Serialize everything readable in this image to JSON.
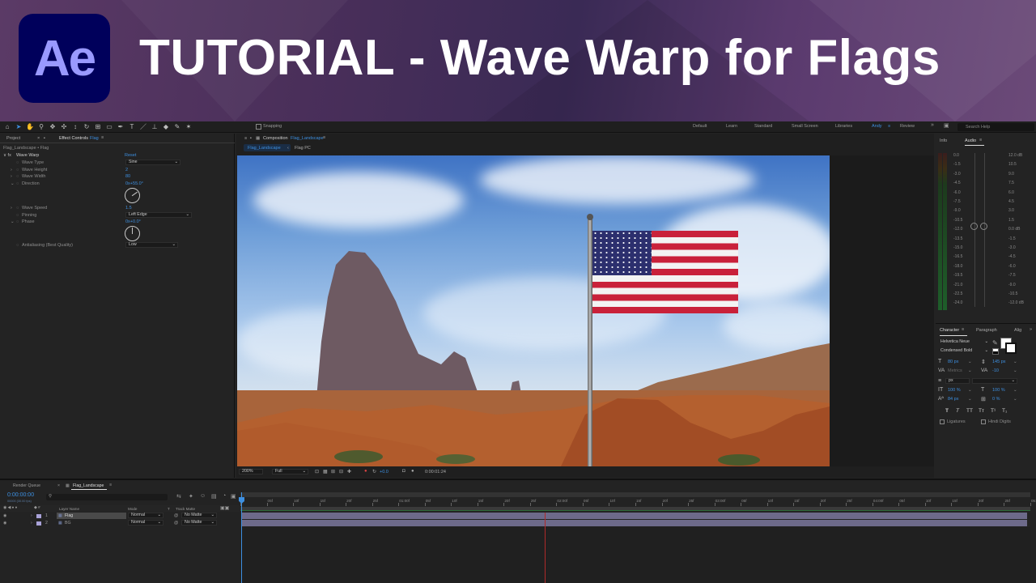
{
  "banner": {
    "logo_text": "Ae",
    "title": "TUTORIAL - Wave Warp for Flags",
    "logo_bg": "#00005b",
    "logo_fg": "#9999ff"
  },
  "toolbar": {
    "snapping_label": "Snapping",
    "workspaces": [
      "Default",
      "Learn",
      "Standard",
      "Small Screen",
      "Libraries",
      "Andy",
      "Review"
    ],
    "active_workspace": "Andy",
    "search_placeholder": "Search Help"
  },
  "left_panel": {
    "tab_project": "Project",
    "tab_effect_controls": "Effect Controls",
    "tab_effect_target": "Flag",
    "layer_path": "Flag_Landscape • Flag",
    "effect_name": "Wave Warp",
    "reset_label": "Reset",
    "properties": [
      {
        "label": "Wave Type",
        "value": "Sine",
        "kind": "dropdown"
      },
      {
        "label": "Wave Height",
        "value": "2",
        "kind": "number"
      },
      {
        "label": "Wave Width",
        "value": "80",
        "kind": "number"
      },
      {
        "label": "Direction",
        "value": "0x+55.0°",
        "kind": "angle"
      },
      {
        "label": "Wave Speed",
        "value": "1.5",
        "kind": "number"
      },
      {
        "label": "Pinning",
        "value": "Left Edge",
        "kind": "dropdown"
      },
      {
        "label": "Phase",
        "value": "0x+0.0°",
        "kind": "angle"
      },
      {
        "label": "Antialiasing (Best Quality)",
        "value": "Low",
        "kind": "dropdown"
      }
    ]
  },
  "comp_panel": {
    "tab_label": "Composition",
    "comp_name": "Flag_Landscape",
    "breadcrumb_1": "Flag_Landscape",
    "breadcrumb_2": "Flag PC",
    "zoom": "200%",
    "resolution": "Full",
    "exposure": "+0.0",
    "timecode": "0:00:01:24"
  },
  "right_panel": {
    "tab_info": "Info",
    "tab_audio": "Audio",
    "meter_left": [
      "0.0",
      "-1.5",
      "-3.0",
      "-4.5",
      "-6.0",
      "-7.5",
      "-9.0",
      "-10.5",
      "-12.0",
      "-13.5",
      "-15.0",
      "-16.5",
      "-18.0",
      "-19.5",
      "-21.0",
      "-22.5",
      "-24.0"
    ],
    "meter_right": [
      "12.0 dB",
      "10.5",
      "9.0",
      "7.5",
      "6.0",
      "4.5",
      "3.0",
      "1.5",
      "0.0 dB",
      "-1.5",
      "-3.0",
      "-4.5",
      "-6.0",
      "-7.5",
      "-9.0",
      "-10.5",
      "-12.0 dB"
    ],
    "tab_character": "Character",
    "tab_paragraph": "Paragraph",
    "tab_align": "Alig",
    "font_family": "Helvetica Neue",
    "font_style": "Condensed Bold",
    "font_size": "80 px",
    "leading": "145 px",
    "kerning": "Metrics",
    "tracking": "-10",
    "stroke_unit": "px",
    "vscale": "100 %",
    "hscale": "100 %",
    "baseline": "84 px",
    "tsume": "0 %",
    "ligatures": "Ligatures",
    "hindi_digits": "Hindi Digits"
  },
  "timeline": {
    "tab_render_queue": "Render Queue",
    "tab_comp": "Flag_Landscape",
    "current_time": "0:00:00:00",
    "fps": "00000 (30.00 fps)",
    "col_layer_name": "Layer Name",
    "col_mode": "Mode",
    "col_track_matte": "Track Matte",
    "layers": [
      {
        "num": "1",
        "name": "Flag",
        "mode": "Normal",
        "matte": "No Matte",
        "color": "#a9a2d8"
      },
      {
        "num": "2",
        "name": "BG",
        "mode": "Normal",
        "matte": "No Matte",
        "color": "#a9a2d8"
      }
    ],
    "ruler": [
      "0f",
      "05f",
      "10f",
      "15f",
      "20f",
      "25f",
      "01:00f",
      "05f",
      "10f",
      "15f",
      "20f",
      "25f",
      "02:00f",
      "05f",
      "10f",
      "15f",
      "20f",
      "25f",
      "03:00f",
      "05f",
      "10f",
      "15f",
      "20f",
      "25f",
      "04:00f",
      "05f",
      "10f",
      "15f",
      "20f",
      "25f",
      "05:0"
    ]
  }
}
